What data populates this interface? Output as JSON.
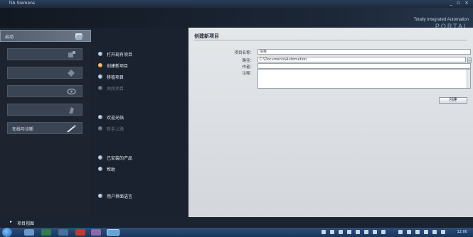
{
  "window": {
    "title": "TIA Siemens",
    "controls": "_ ▫ ×"
  },
  "brand": {
    "line1": "Totally Integrated Automation",
    "line2": "PORTAL"
  },
  "nav": {
    "items": [
      {
        "label": "启动",
        "icon": "start-icon",
        "active": true
      },
      {
        "label": "",
        "icon": "devices-icon",
        "active": false
      },
      {
        "label": "",
        "icon": "plc-icon",
        "active": false
      },
      {
        "label": "",
        "icon": "motion-icon",
        "active": false
      },
      {
        "label": "",
        "icon": "visualization-icon",
        "active": false
      },
      {
        "label": "在线与诊断",
        "icon": "online-diagnostics-icon",
        "active": false
      }
    ]
  },
  "mid": {
    "items": [
      {
        "label": "打开现有项目",
        "state": "normal"
      },
      {
        "label": "创建新项目",
        "state": "active"
      },
      {
        "label": "移植项目",
        "state": "normal"
      },
      {
        "label": "关闭项目",
        "state": "disabled"
      },
      {
        "label": "欢迎光临",
        "state": "normal"
      },
      {
        "label": "新手上路",
        "state": "disabled"
      },
      {
        "label": "已安装的产品",
        "state": "normal"
      },
      {
        "label": "帮助",
        "state": "normal"
      },
      {
        "label": "用户界面语言",
        "state": "normal"
      }
    ]
  },
  "form": {
    "title": "创建新项目",
    "project_name_label": "项目名称：",
    "project_name_value": "项目",
    "path_label": "路径：",
    "path_value": "C:\\Documents\\Automation",
    "browse": "...",
    "author_label": "作者：",
    "author_value": "",
    "comment_label": "注释：",
    "create_button": "创建"
  },
  "footer": {
    "project_view": "项目视图",
    "arrow": "▸"
  },
  "taskbar": {
    "time": "12:00"
  },
  "colors": {
    "accent": "#e07b1f",
    "panel_bg": "#e4e7ea",
    "nav_bg": "#1d2430"
  }
}
